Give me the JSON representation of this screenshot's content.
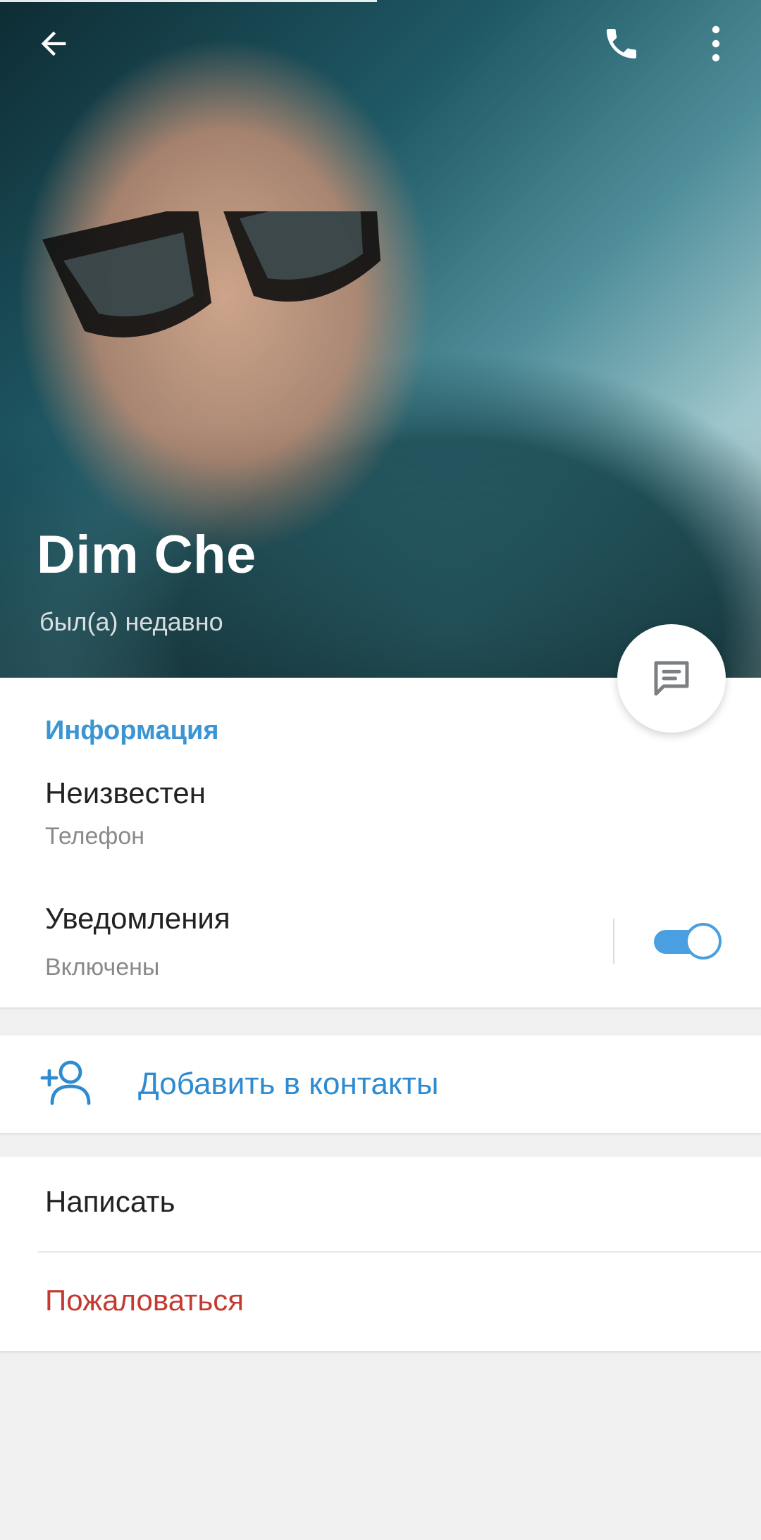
{
  "profile": {
    "name": "Dim Che",
    "status": "был(а) недавно"
  },
  "toolbar": {
    "back_icon": "arrow-left-icon",
    "call_icon": "phone-icon",
    "more_icon": "more-vertical-icon"
  },
  "fab": {
    "icon": "message-icon"
  },
  "info": {
    "title": "Информация",
    "phone_value": "Неизвестен",
    "phone_label": "Телефон",
    "notifications_label": "Уведомления",
    "notifications_state": "Включены",
    "notifications_enabled": true
  },
  "add_contact": {
    "label": "Добавить в контакты",
    "icon": "add-person-icon"
  },
  "actions": {
    "write": "Написать",
    "report": "Пожаловаться"
  },
  "colors": {
    "accent": "#3a95d2",
    "link": "#2e8bd0",
    "danger": "#c43a31",
    "switch_on": "#4a9fe0"
  }
}
